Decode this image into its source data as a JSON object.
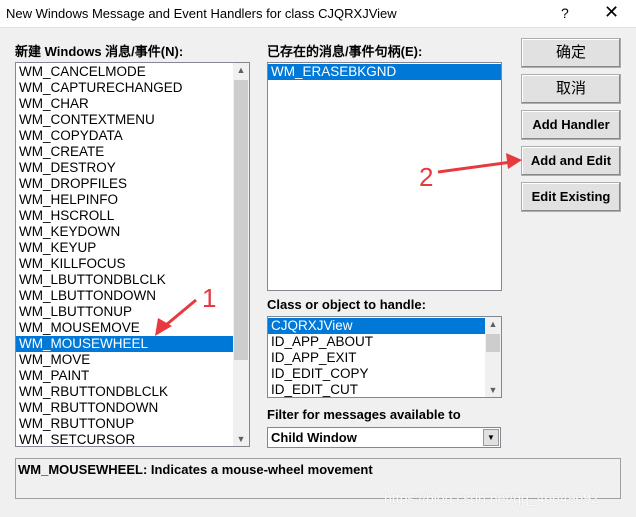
{
  "window": {
    "title": "New Windows Message and Event Handlers for class CJQRXJView",
    "help": "?",
    "close": "✕"
  },
  "new_messages": {
    "label": "新建 Windows 消息/事件(N):",
    "items": [
      "WM_CANCELMODE",
      "WM_CAPTURECHANGED",
      "WM_CHAR",
      "WM_CONTEXTMENU",
      "WM_COPYDATA",
      "WM_CREATE",
      "WM_DESTROY",
      "WM_DROPFILES",
      "WM_HELPINFO",
      "WM_HSCROLL",
      "WM_KEYDOWN",
      "WM_KEYUP",
      "WM_KILLFOCUS",
      "WM_LBUTTONDBLCLK",
      "WM_LBUTTONDOWN",
      "WM_LBUTTONUP",
      "WM_MOUSEMOVE",
      "WM_MOUSEWHEEL",
      "WM_MOVE",
      "WM_PAINT",
      "WM_RBUTTONDBLCLK",
      "WM_RBUTTONDOWN",
      "WM_RBUTTONUP",
      "WM_SETCURSOR"
    ],
    "selected": "WM_MOUSEWHEEL"
  },
  "existing": {
    "label": "已存在的消息/事件句柄(E):",
    "items": [
      "WM_ERASEBKGND"
    ],
    "selected": "WM_ERASEBKGND"
  },
  "buttons": {
    "ok": "确定",
    "cancel": "取消",
    "add_handler": "Add Handler",
    "add_edit": "Add and Edit",
    "edit_existing": "Edit Existing"
  },
  "class_list": {
    "label": "Class or object to handle:",
    "items": [
      "CJQRXJView",
      "ID_APP_ABOUT",
      "ID_APP_EXIT",
      "ID_EDIT_COPY",
      "ID_EDIT_CUT"
    ],
    "selected": "CJQRXJView"
  },
  "filter": {
    "label": "Filter for messages available to",
    "value": "Child Window"
  },
  "description": "WM_MOUSEWHEEL:  Indicates a mouse-wheel movement",
  "annotations": {
    "one": "1",
    "two": "2",
    "color": "#e8393f"
  },
  "watermark": "https://blog.csdn.net/qq_46649692"
}
